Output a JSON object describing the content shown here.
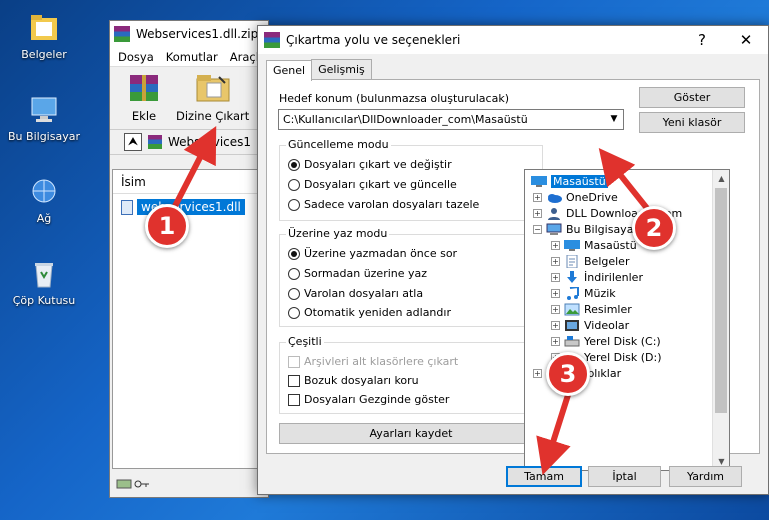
{
  "desktop": {
    "icons": [
      {
        "label": "Belgeler",
        "icon": "documents-folder-icon"
      },
      {
        "label": "Bu Bilgisayar",
        "icon": "computer-icon"
      },
      {
        "label": "Ağ",
        "icon": "network-icon"
      },
      {
        "label": "Çöp Kutusu",
        "icon": "recycle-bin-icon"
      }
    ]
  },
  "winrar": {
    "title": "Webservices1.dll.zip",
    "menu": [
      "Dosya",
      "Komutlar",
      "Araçla"
    ],
    "toolbar": {
      "add_label": "Ekle",
      "extract_label": "Dizine Çıkart"
    },
    "address": "Webservices1",
    "list": {
      "column_name": "İsim",
      "file": "webservices1.dll"
    }
  },
  "dialog": {
    "title": "Çıkartma yolu ve seçenekleri",
    "help_glyph": "?",
    "close_glyph": "✕",
    "tabs": [
      "Genel",
      "Gelişmiş"
    ],
    "destination_label": "Hedef konum (bulunmazsa oluşturulacak)",
    "destination_value": "C:\\Kullanıcılar\\DllDownloader_com\\Masaüstü",
    "show_button": "Göster",
    "new_folder_button": "Yeni klasör",
    "update_mode": {
      "title": "Güncelleme modu",
      "options": [
        "Dosyaları çıkart ve değiştir",
        "Dosyaları çıkart ve güncelle",
        "Sadece varolan dosyaları tazele"
      ],
      "selected": 0
    },
    "overwrite_mode": {
      "title": "Üzerine yaz modu",
      "options": [
        "Üzerine yazmadan önce sor",
        "Sormadan üzerine yaz",
        "Varolan dosyaları atla",
        "Otomatik yeniden adlandır"
      ],
      "selected": 0
    },
    "misc": {
      "title": "Çeşitli",
      "options": [
        "Arşivleri alt klasörlere çıkart",
        "Bozuk dosyaları koru",
        "Dosyaları Gezginde göster"
      ]
    },
    "save_settings_button": "Ayarları kaydet",
    "tree": [
      {
        "label": "Masaüstü",
        "icon": "desktop-icon"
      },
      {
        "label": "OneDrive",
        "icon": "onedrive-icon"
      },
      {
        "label": "DLL Downloader.com",
        "icon": "user-icon"
      },
      {
        "label": "Bu Bilgisayar",
        "icon": "computer-icon"
      },
      {
        "label": "Masaüstü",
        "icon": "desktop-icon"
      },
      {
        "label": "Belgeler",
        "icon": "documents-icon"
      },
      {
        "label": "İndirilenler",
        "icon": "downloads-icon"
      },
      {
        "label": "Müzik",
        "icon": "music-icon"
      },
      {
        "label": "Resimler",
        "icon": "pictures-icon"
      },
      {
        "label": "Videolar",
        "icon": "videos-icon"
      },
      {
        "label": "Yerel Disk (C:)",
        "icon": "drive-icon"
      },
      {
        "label": "Yerel Disk (D:)",
        "icon": "drive-icon"
      },
      {
        "label": "Kitaplıklar",
        "icon": "libraries-icon"
      }
    ],
    "ok_button": "Tamam",
    "cancel_button": "İptal",
    "help_button": "Yardım"
  },
  "annotations": [
    "1",
    "2",
    "3"
  ],
  "annotation_color": "#e0322d"
}
